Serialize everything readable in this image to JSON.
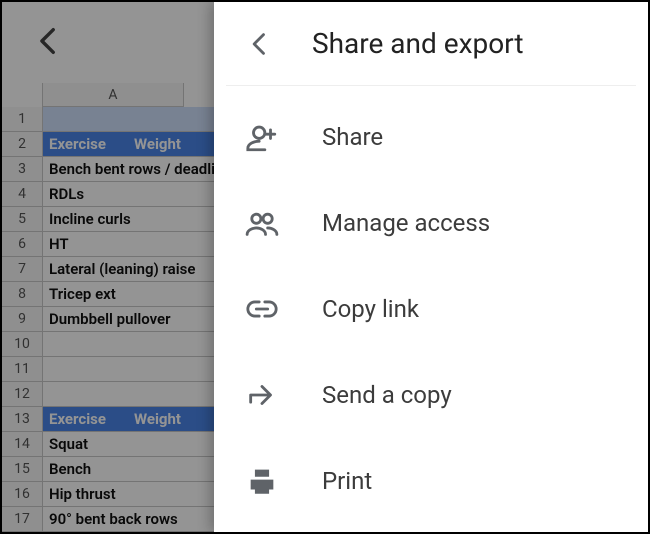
{
  "sheet": {
    "col_header": "A",
    "rows": [
      {
        "n": "1",
        "type": "selected",
        "a": ""
      },
      {
        "n": "2",
        "type": "header",
        "a": "Exercise",
        "b": "Weight"
      },
      {
        "n": "3",
        "type": "data",
        "a": "Bench bent rows / deadlift"
      },
      {
        "n": "4",
        "type": "data",
        "a": "RDLs"
      },
      {
        "n": "5",
        "type": "data",
        "a": "Incline curls"
      },
      {
        "n": "6",
        "type": "data",
        "a": "HT"
      },
      {
        "n": "7",
        "type": "data",
        "a": "Lateral (leaning) raise"
      },
      {
        "n": "8",
        "type": "data",
        "a": "Tricep ext"
      },
      {
        "n": "9",
        "type": "data",
        "a": "Dumbbell pullover"
      },
      {
        "n": "10",
        "type": "data",
        "a": ""
      },
      {
        "n": "11",
        "type": "data",
        "a": ""
      },
      {
        "n": "12",
        "type": "data",
        "a": ""
      },
      {
        "n": "13",
        "type": "header",
        "a": "Exercise",
        "b": "Weight"
      },
      {
        "n": "14",
        "type": "data",
        "a": "Squat"
      },
      {
        "n": "15",
        "type": "data",
        "a": "Bench"
      },
      {
        "n": "16",
        "type": "data",
        "a": "Hip thrust"
      },
      {
        "n": "17",
        "type": "data",
        "a": "90° bent back rows"
      }
    ]
  },
  "panel": {
    "title": "Share and export",
    "items": [
      {
        "icon": "person-add-icon",
        "label": "Share"
      },
      {
        "icon": "people-icon",
        "label": "Manage access"
      },
      {
        "icon": "link-icon",
        "label": "Copy link"
      },
      {
        "icon": "send-icon",
        "label": "Send a copy"
      },
      {
        "icon": "print-icon",
        "label": "Print"
      }
    ]
  }
}
